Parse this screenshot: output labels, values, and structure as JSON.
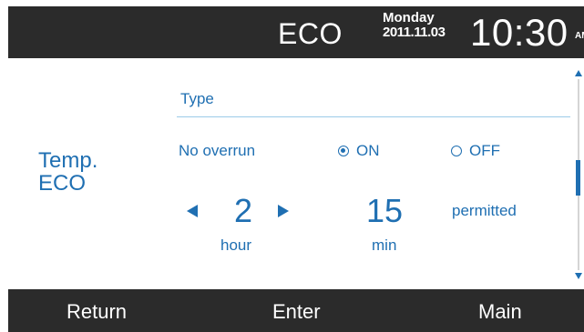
{
  "header": {
    "title": "ECO",
    "day": "Monday",
    "date": "2011.11.03",
    "time": "10:30",
    "ampm": "AM"
  },
  "side_label": {
    "line1": "Temp.",
    "line2": "ECO"
  },
  "settings": {
    "type_label": "Type",
    "overrun_label": "No overrun",
    "options": {
      "on": "ON",
      "off": "OFF",
      "selected": "ON"
    },
    "hour_value": "2",
    "hour_unit": "hour",
    "min_value": "15",
    "min_unit": "min",
    "permitted": "permitted"
  },
  "footer": {
    "return_label": "Return",
    "enter_label": "Enter",
    "main_label": "Main"
  },
  "colors": {
    "accent": "#1f6fb2",
    "bar_background": "#2b2b2b",
    "background": "#ffffff"
  },
  "icons": {
    "arrow_left": "triangle-left-icon",
    "arrow_right": "triangle-right-icon",
    "scroll_up": "scroll-up-arrow-icon",
    "scroll_down": "scroll-down-arrow-icon"
  }
}
